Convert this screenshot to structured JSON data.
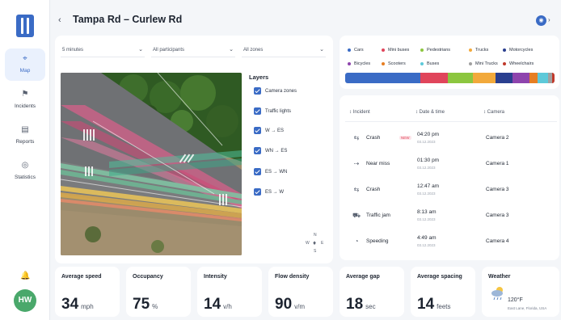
{
  "header": {
    "back_icon": "chevron-left-icon",
    "title": "Tampa Rd – Curlew Rd"
  },
  "sidebar": {
    "items": [
      {
        "label": "Map",
        "icon": "map-pin-icon",
        "active": true
      },
      {
        "label": "Incidents",
        "icon": "incident-icon",
        "active": false
      },
      {
        "label": "Reports",
        "icon": "report-icon",
        "active": false
      },
      {
        "label": "Statistics",
        "icon": "statistics-icon",
        "active": false
      }
    ],
    "avatar": "HW"
  },
  "filters": {
    "interval": "5 minutes",
    "participants": "All participants",
    "zones": "All zones"
  },
  "layers": {
    "title": "Layers",
    "items": [
      "Camera zones",
      "Traffic lights",
      "W → ES",
      "WN → ES",
      "ES → WN",
      "ES → W"
    ]
  },
  "compass": {
    "n": "N",
    "w": "W",
    "e": "E",
    "s": "S"
  },
  "legend": {
    "items": [
      {
        "label": "Cars",
        "color": "#3a6bc5"
      },
      {
        "label": "Mini buses",
        "color": "#e0455b"
      },
      {
        "label": "Pedestrians",
        "color": "#8cc63f"
      },
      {
        "label": "Trucks",
        "color": "#f2a93b"
      },
      {
        "label": "Motorcycles",
        "color": "#2a3f8f"
      },
      {
        "label": "Bicycles",
        "color": "#8e44ad"
      },
      {
        "label": "Scooters",
        "color": "#e67e22"
      },
      {
        "label": "Buses",
        "color": "#5dc9d9"
      },
      {
        "label": "Mini Trucks",
        "color": "#a0a0a0"
      },
      {
        "label": "Wheelchairs",
        "color": "#c0392b"
      }
    ],
    "distribution": [
      0.36,
      0.13,
      0.12,
      0.11,
      0.08,
      0.08,
      0.04,
      0.05,
      0.02,
      0.01
    ]
  },
  "incidents": {
    "columns": [
      "Incident",
      "Date & time",
      "Camera"
    ],
    "rows": [
      {
        "icon": "crash-icon",
        "name": "Crash",
        "badge": "NEW",
        "time": "04:20 pm",
        "date": "03.12.2023",
        "camera": "Camera 2"
      },
      {
        "icon": "near-miss-icon",
        "name": "Near miss",
        "badge": "",
        "time": "01:30 pm",
        "date": "03.12.2023",
        "camera": "Camera 1"
      },
      {
        "icon": "crash-icon",
        "name": "Crash",
        "badge": "",
        "time": "12:47 am",
        "date": "03.12.2023",
        "camera": "Camera 3"
      },
      {
        "icon": "traffic-jam-icon",
        "name": "Traffic jam",
        "badge": "",
        "time": "8:13 am",
        "date": "03.12.2023",
        "camera": "Camera 3"
      },
      {
        "icon": "speeding-icon",
        "name": "Speeding",
        "badge": "",
        "time": "4:49 am",
        "date": "03.12.2023",
        "camera": "Camera 4"
      }
    ]
  },
  "stats": [
    {
      "label": "Average speed",
      "value": "34",
      "unit": "mph"
    },
    {
      "label": "Occupancy",
      "value": "75",
      "unit": "%"
    },
    {
      "label": "Intensity",
      "value": "14",
      "unit": "v/h"
    },
    {
      "label": "Flow density",
      "value": "90",
      "unit": "v/m"
    },
    {
      "label": "Average gap",
      "value": "18",
      "unit": "sec"
    },
    {
      "label": "Average spacing",
      "value": "14",
      "unit": "feets"
    }
  ],
  "weather": {
    "label": "Weather",
    "temp": "120°F",
    "location": "East Lane, Florida, USA",
    "icon": "cloudy-rain-icon"
  }
}
